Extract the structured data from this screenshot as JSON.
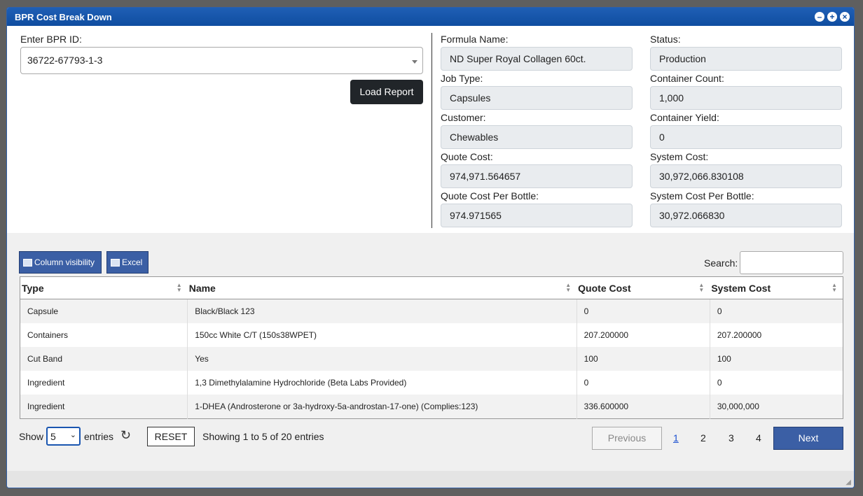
{
  "window": {
    "title": "BPR Cost Break Down",
    "controls": [
      "–",
      "+",
      "×"
    ]
  },
  "bpr": {
    "label": "Enter BPR ID:",
    "value": "36722-67793-1-3",
    "load_button": "Load Report"
  },
  "info": {
    "formula_name": {
      "label": "Formula Name:",
      "value": "ND Super Royal Collagen 60ct."
    },
    "status": {
      "label": "Status:",
      "value": "Production"
    },
    "job_type": {
      "label": "Job Type:",
      "value": "Capsules"
    },
    "container_count": {
      "label": "Container Count:",
      "value": "1,000"
    },
    "customer": {
      "label": "Customer:",
      "value": "Chewables"
    },
    "container_yield": {
      "label": "Container Yield:",
      "value": "0"
    },
    "quote_cost": {
      "label": "Quote Cost:",
      "value": "974,971.564657"
    },
    "system_cost": {
      "label": "System Cost:",
      "value": "30,972,066.830108"
    },
    "quote_cost_per_bottle": {
      "label": "Quote Cost Per Bottle:",
      "value": "974.971565"
    },
    "system_cost_per_bottle": {
      "label": "System Cost Per Bottle:",
      "value": "30,972.066830"
    }
  },
  "toolbar": {
    "column_visibility": "Column visibility",
    "excel": "Excel",
    "search_label": "Search:",
    "search_value": ""
  },
  "table": {
    "columns": [
      "Type",
      "Name",
      "Quote Cost",
      "System Cost"
    ],
    "rows": [
      [
        "Capsule",
        "Black/Black 123",
        "0",
        "0"
      ],
      [
        "Containers",
        "150cc White C/T (150s38WPET)",
        "207.200000",
        "207.200000"
      ],
      [
        "Cut Band",
        "Yes",
        "100",
        "100"
      ],
      [
        "Ingredient",
        "1,3 Dimethylalamine Hydrochloride (Beta Labs Provided)",
        "0",
        "0"
      ],
      [
        "Ingredient",
        "1-DHEA (Androsterone or 3a-hydroxy-5a-androstan-17-one) (Complies:123)",
        "336.600000",
        "30,000,000"
      ]
    ]
  },
  "footer": {
    "show_label": "Show",
    "entries_value": "5",
    "entries_label": "entries",
    "reset": "RESET",
    "info": "Showing 1 to 5 of 20 entries",
    "previous": "Previous",
    "pages": [
      "1",
      "2",
      "3",
      "4"
    ],
    "next": "Next"
  }
}
